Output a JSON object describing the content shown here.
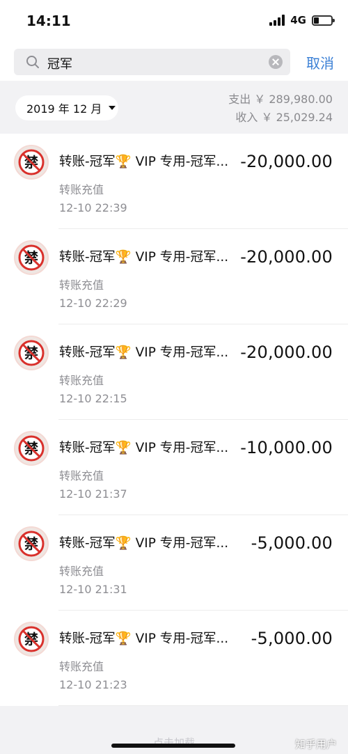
{
  "status": {
    "time": "14:11",
    "network": "4G"
  },
  "search": {
    "query": "冠军",
    "cancel_label": "取消"
  },
  "summary": {
    "month": "2019 年 12 月",
    "expense": "支出 ￥ 289,980.00",
    "income": "收入 ￥ 25,029.24"
  },
  "transactions": [
    {
      "title_prefix": "转账-冠军",
      "trophy": "🏆",
      "title_suffix": " VIP 专用-冠军...",
      "amount": "-20,000.00",
      "subtitle": "转账充值",
      "time": "12-10 22:39"
    },
    {
      "title_prefix": "转账-冠军",
      "trophy": "🏆",
      "title_suffix": " VIP 专用-冠军...",
      "amount": "-20,000.00",
      "subtitle": "转账充值",
      "time": "12-10 22:29"
    },
    {
      "title_prefix": "转账-冠军",
      "trophy": "🏆",
      "title_suffix": " VIP 专用-冠军...",
      "amount": "-20,000.00",
      "subtitle": "转账充值",
      "time": "12-10 22:15"
    },
    {
      "title_prefix": "转账-冠军",
      "trophy": "🏆",
      "title_suffix": " VIP 专用-冠军...",
      "amount": "-10,000.00",
      "subtitle": "转账充值",
      "time": "12-10 21:37"
    },
    {
      "title_prefix": "转账-冠军",
      "trophy": "🏆",
      "title_suffix": " VIP 专用-冠军...",
      "amount": "-5,000.00",
      "subtitle": "转账充值",
      "time": "12-10 21:31"
    },
    {
      "title_prefix": "转账-冠军",
      "trophy": "🏆",
      "title_suffix": " VIP 专用-冠军...",
      "amount": "-5,000.00",
      "subtitle": "转账充值",
      "time": "12-10 21:23"
    }
  ],
  "footer": {
    "load_more": "点击加载",
    "watermark": "知乎用户"
  },
  "colors": {
    "accent": "#3a7fd5",
    "background": "#f2f2f4",
    "prohibit_red": "#d9302b"
  },
  "icons": {
    "avatar": "prohibited-sign-icon",
    "search": "search-icon",
    "clear": "clear-icon",
    "dropdown": "caret-down-icon"
  }
}
